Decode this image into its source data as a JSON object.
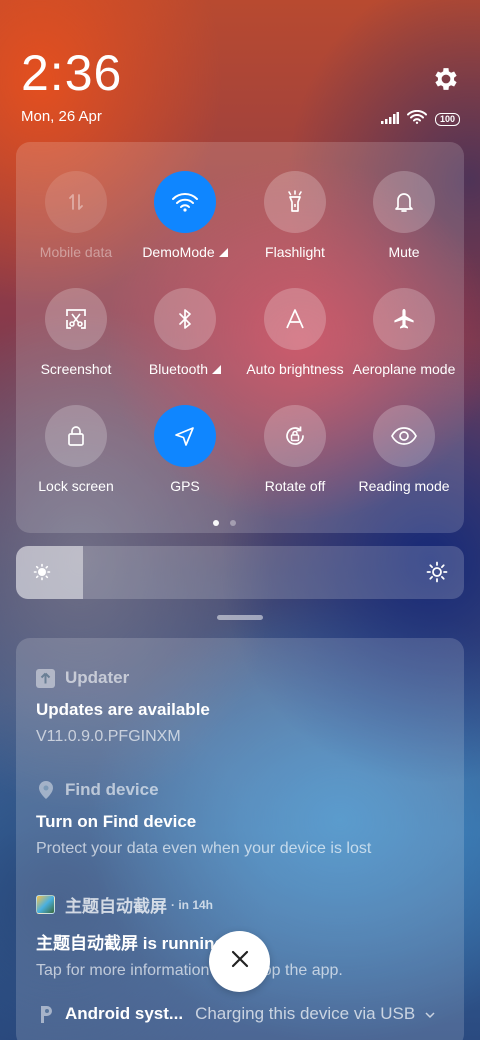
{
  "header": {
    "time": "2:36",
    "date": "Mon, 26 Apr",
    "battery": "100"
  },
  "quick_settings": {
    "tiles": [
      {
        "label": "Mobile data",
        "icon": "mobile-data-icon",
        "state": "disabled"
      },
      {
        "label": "DemoMode",
        "icon": "wifi-icon",
        "state": "on",
        "expandable": true
      },
      {
        "label": "Flashlight",
        "icon": "flashlight-icon",
        "state": "off"
      },
      {
        "label": "Mute",
        "icon": "bell-icon",
        "state": "off"
      },
      {
        "label": "Screenshot",
        "icon": "screenshot-icon",
        "state": "off"
      },
      {
        "label": "Bluetooth",
        "icon": "bluetooth-icon",
        "state": "off",
        "expandable": true
      },
      {
        "label": "Auto brightness",
        "icon": "auto-brightness-icon",
        "state": "off"
      },
      {
        "label": "Aeroplane mode",
        "icon": "airplane-icon",
        "state": "off"
      },
      {
        "label": "Lock screen",
        "icon": "lock-icon",
        "state": "off"
      },
      {
        "label": "GPS",
        "icon": "location-arrow-icon",
        "state": "on"
      },
      {
        "label": "Rotate off",
        "icon": "rotate-lock-icon",
        "state": "off"
      },
      {
        "label": "Reading mode",
        "icon": "eye-icon",
        "state": "off"
      }
    ],
    "page_count": 2,
    "active_page": 1,
    "accent_color": "#0f86ff"
  },
  "brightness": {
    "level": 0.15
  },
  "notifications": [
    {
      "app": "Updater",
      "icon": "updater-icon",
      "title": "Updates are available",
      "text": "V11.0.9.0.PFGINXM"
    },
    {
      "app": "Find device",
      "icon": "location-pin-icon",
      "title": "Turn on Find device",
      "text": "Protect your data even when your device is lost"
    },
    {
      "app": "主题自动截屏",
      "time": "· in 14h",
      "icon": "app-thumbnail-icon",
      "title": "主题自动截屏 is running",
      "text": "Tap for more information or to stop the app."
    },
    {
      "app": "Android syst...",
      "icon": "android-system-icon",
      "text": "Charging this device via USB"
    }
  ]
}
